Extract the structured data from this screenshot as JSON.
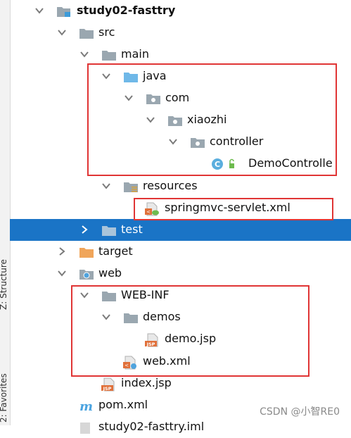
{
  "sidebar": {
    "structure_label": "Z: Structure",
    "favorites_label": "2: Favorites"
  },
  "tree": [
    {
      "label": "study02-fasttry"
    },
    {
      "label": "src"
    },
    {
      "label": "main"
    },
    {
      "label": "java"
    },
    {
      "label": "com"
    },
    {
      "label": "xiaozhi"
    },
    {
      "label": "controller"
    },
    {
      "label": "DemoControlle"
    },
    {
      "label": "resources"
    },
    {
      "label": "springmvc-servlet.xml"
    },
    {
      "label": "test"
    },
    {
      "label": "target"
    },
    {
      "label": "web"
    },
    {
      "label": "WEB-INF"
    },
    {
      "label": "demos"
    },
    {
      "label": "demo.jsp"
    },
    {
      "label": "web.xml"
    },
    {
      "label": "index.jsp"
    },
    {
      "label": "pom.xml"
    },
    {
      "label": "study02-fasttry.iml"
    }
  ],
  "watermark": "CSDN @小智RE0",
  "colors": {
    "selection": "#1a74c6",
    "highlight_box": "#e03535",
    "folder": "#9aa7b0",
    "source_folder": "#6fb8e8",
    "excluded_folder": "#f0a55a"
  },
  "icons": {
    "project": "module-folder-icon",
    "folder": "folder-icon",
    "source_root": "source-folder-icon",
    "package": "package-icon",
    "class": "java-class-icon",
    "resources_root": "resources-folder-icon",
    "xml": "xml-file-icon",
    "jsp": "jsp-file-icon",
    "maven": "maven-pom-icon"
  }
}
